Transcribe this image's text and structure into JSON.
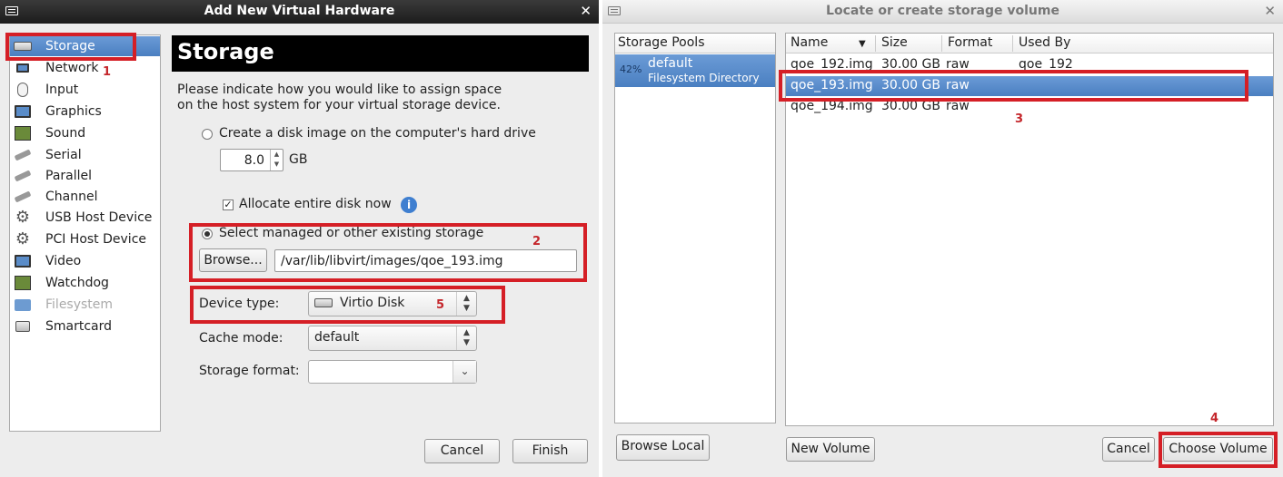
{
  "left_window": {
    "title": "Add New Virtual Hardware",
    "hardware_items": [
      {
        "label": "Storage",
        "icon": "disk-icon",
        "selected": true
      },
      {
        "label": "Network",
        "icon": "network-icon"
      },
      {
        "label": "Input",
        "icon": "mouse-icon"
      },
      {
        "label": "Graphics",
        "icon": "monitor-icon"
      },
      {
        "label": "Sound",
        "icon": "sound-card-icon"
      },
      {
        "label": "Serial",
        "icon": "serial-plug-icon"
      },
      {
        "label": "Parallel",
        "icon": "parallel-plug-icon"
      },
      {
        "label": "Channel",
        "icon": "channel-plug-icon"
      },
      {
        "label": "USB Host Device",
        "icon": "usb-gear-icon"
      },
      {
        "label": "PCI Host Device",
        "icon": "pci-gear-icon"
      },
      {
        "label": "Video",
        "icon": "video-monitor-icon"
      },
      {
        "label": "Watchdog",
        "icon": "watchdog-chip-icon"
      },
      {
        "label": "Filesystem",
        "icon": "folder-icon",
        "disabled": true
      },
      {
        "label": "Smartcard",
        "icon": "smartcard-icon"
      }
    ],
    "header": "Storage",
    "description_line1": "Please indicate how you would like to assign space",
    "description_line2": "on the host system for your virtual storage device.",
    "create_disk_label": "Create a disk image on the computer's hard drive",
    "disk_size_value": "8.0",
    "disk_size_unit": "GB",
    "allocate_label": "Allocate entire disk now",
    "select_existing_label": "Select managed or other existing storage",
    "browse_label": "Browse...",
    "path_value": "/var/lib/libvirt/images/qoe_193.img",
    "device_type_label": "Device type:",
    "device_type_value": "Virtio Disk",
    "cache_mode_label": "Cache mode:",
    "cache_mode_value": "default",
    "storage_format_label": "Storage format:",
    "storage_format_value": "",
    "cancel_label": "Cancel",
    "finish_label": "Finish"
  },
  "right_window": {
    "title": "Locate or create storage volume",
    "pools_header": "Storage Pools",
    "pool": {
      "percent": "42%",
      "name": "default",
      "type": "Filesystem Directory"
    },
    "columns": [
      "Name",
      "Size",
      "Format",
      "Used By"
    ],
    "volumes": [
      {
        "name": "qoe_192.img",
        "size": "30.00 GB",
        "format": "raw",
        "used_by": "qoe_192"
      },
      {
        "name": "qoe_193.img",
        "size": "30.00 GB",
        "format": "raw",
        "used_by": "",
        "selected": true
      },
      {
        "name": "qoe_194.img",
        "size": "30.00 GB",
        "format": "raw",
        "used_by": ""
      }
    ],
    "browse_local_label": "Browse Local",
    "new_volume_label": "New Volume",
    "cancel_label": "Cancel",
    "choose_volume_label": "Choose Volume"
  },
  "annotations": [
    "1",
    "2",
    "3",
    "4",
    "5"
  ],
  "colors": {
    "selection": "#4a7fc1",
    "annotation": "#d51f26",
    "header_bg": "#000000"
  }
}
